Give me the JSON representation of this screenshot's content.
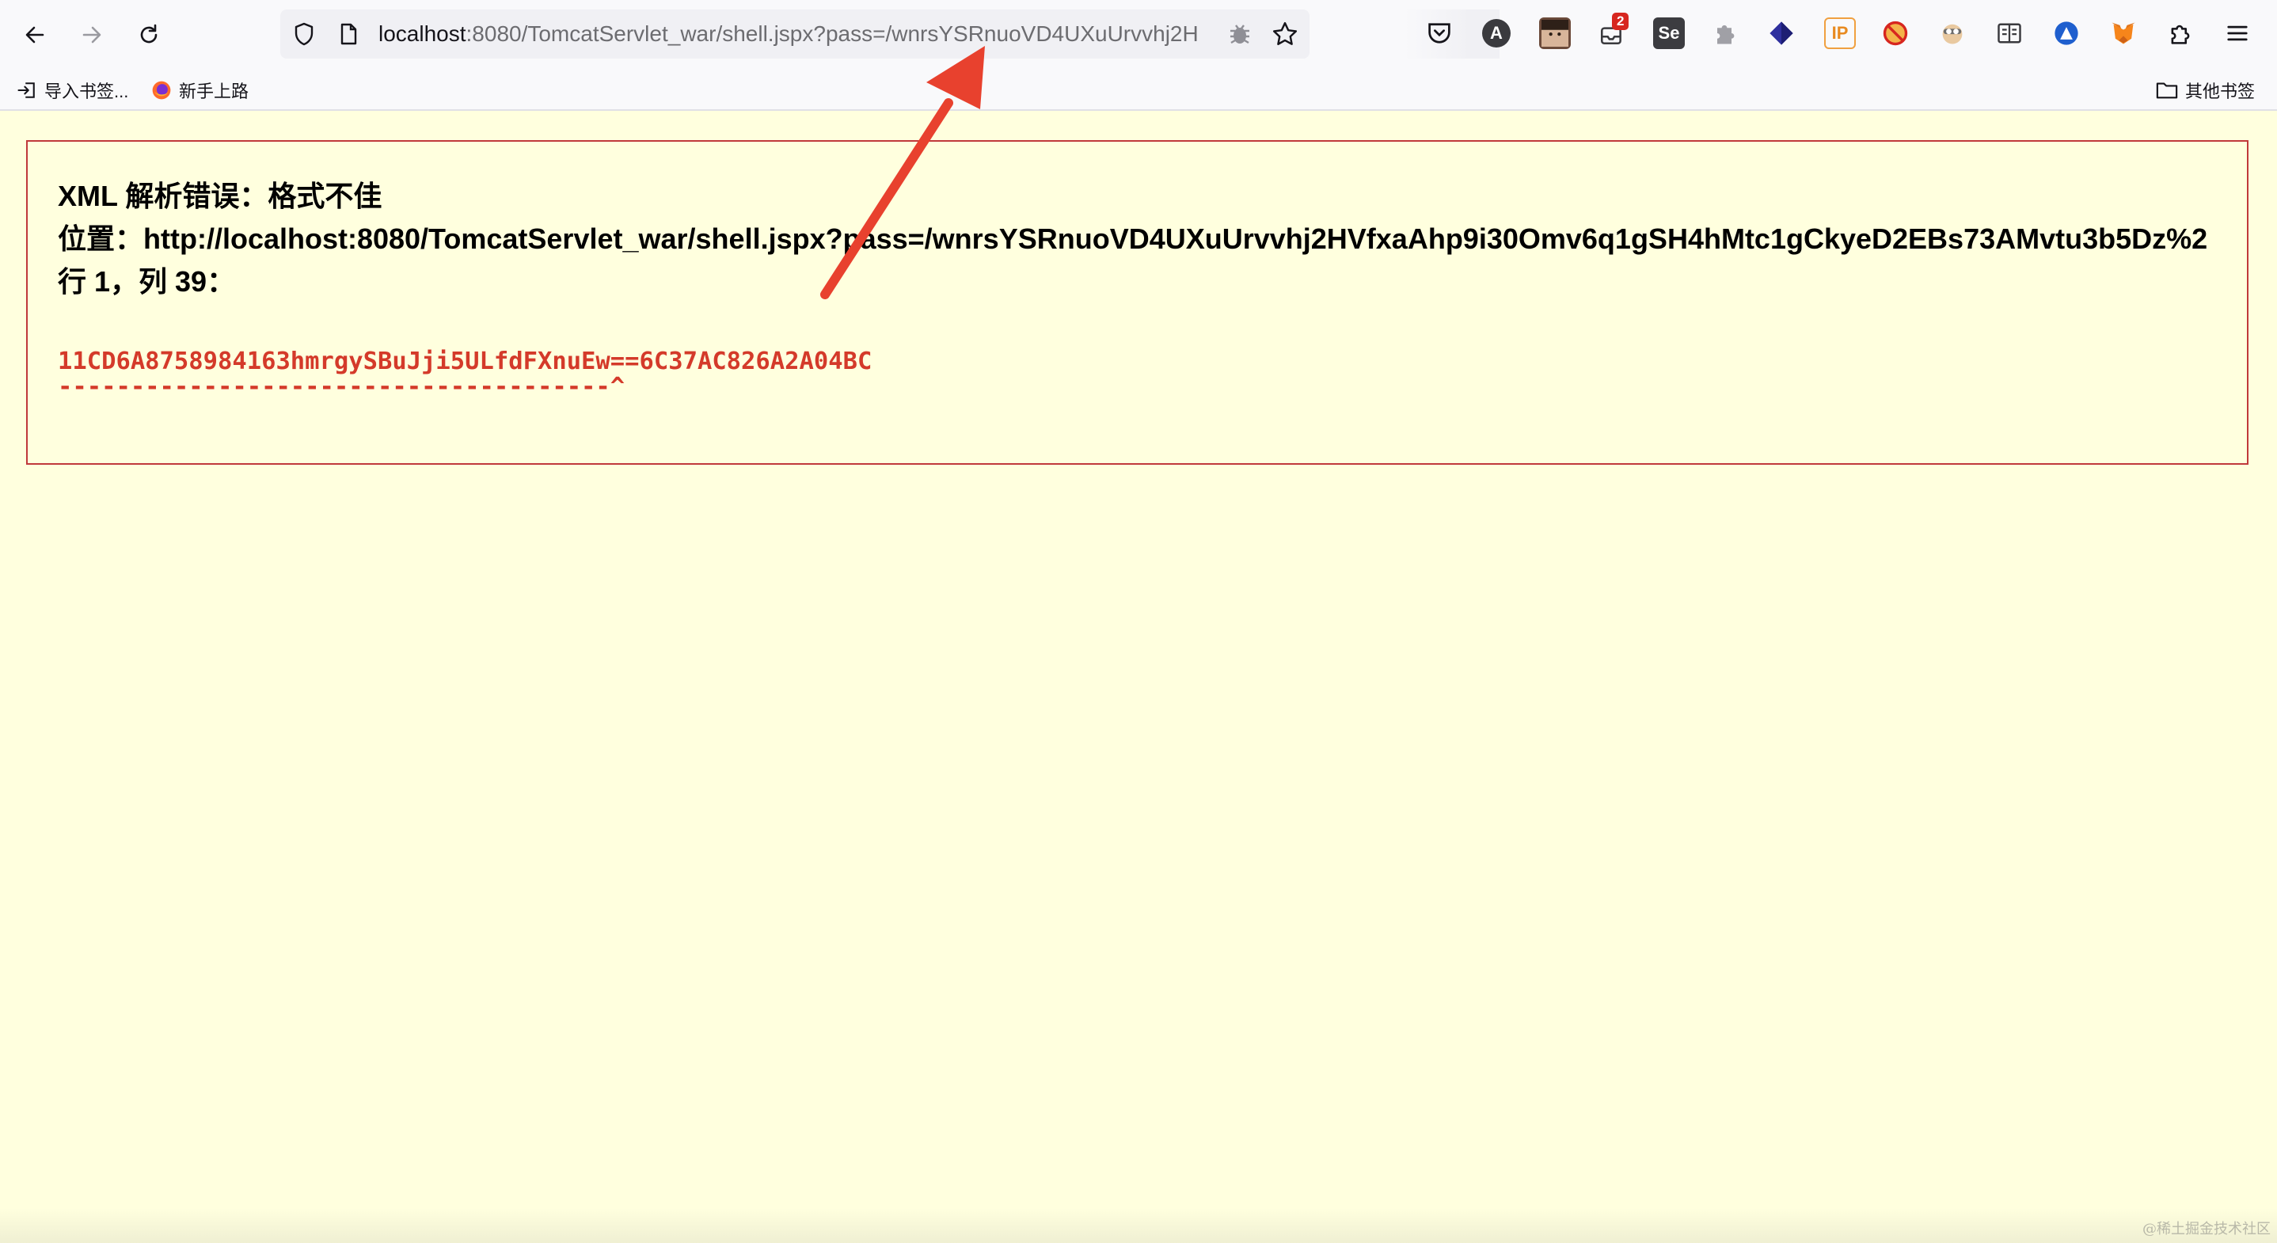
{
  "browser": {
    "url_host": "localhost",
    "url_rest": ":8080/TomcatServlet_war/shell.jspx?pass=/wnrsYSRnuoVD4UXuUrvvhj2H",
    "notification_badge": "2",
    "extension_se_label": "Se",
    "extension_ip_label": "IP",
    "extension_a_label": "A"
  },
  "bookmarks": {
    "import_label": "导入书签...",
    "getting_started_label": "新手上路",
    "other_label": "其他书签"
  },
  "error": {
    "title": "XML 解析错误：格式不佳",
    "location": "位置：http://localhost:8080/TomcatServlet_war/shell.jspx?pass=/wnrsYSRnuoVD4UXuUrvvhj2HVfxaAhp9i30Omv6q1gSH4hMtc1gCkyeD2EBs73AMvtu3b5Dz%2",
    "position": "行 1，列 39：",
    "source_line": "11CD6A8758984163hmrgySBuJji5ULfdFXnuEw==6C37AC826A2A04BC",
    "caret_line": "--------------------------------------^"
  },
  "watermark": "@稀土掘金技术社区",
  "colors": {
    "page_bg": "#ffffde",
    "error_border": "#c0393b",
    "source_text": "#d43a2a",
    "arrow": "#e8412e"
  }
}
